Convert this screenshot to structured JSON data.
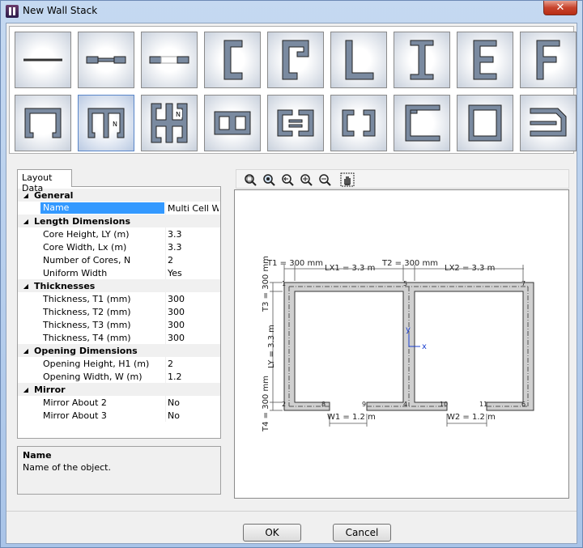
{
  "window": {
    "title": "New Wall Stack",
    "close_glyph": "✕"
  },
  "gallery": {
    "shapes": [
      "straight-wall",
      "wall-with-opening",
      "wall-with-gap",
      "c-section",
      "hooked-c-section",
      "l-section",
      "i-section",
      "e-section",
      "f-section",
      "rectangular-core-with-openings",
      "multi-cell-core",
      "multi-cell-grid",
      "double-wall",
      "twin-channel",
      "box-core-openings",
      "channel-core",
      "octagonal-core",
      "bent-wall"
    ],
    "selected_index": 10
  },
  "tab": {
    "label": "Layout Data"
  },
  "grid": {
    "rows": [
      {
        "type": "cat",
        "label": "General"
      },
      {
        "type": "prop",
        "key": "Name",
        "value": "Multi Cell Wall",
        "selected": true
      },
      {
        "type": "cat",
        "label": "Length Dimensions"
      },
      {
        "type": "prop",
        "key": "Core Height, LY (m)",
        "value": "3.3"
      },
      {
        "type": "prop",
        "key": "Core Width, Lx (m)",
        "value": "3.3"
      },
      {
        "type": "prop",
        "key": "Number of Cores, N",
        "value": "2"
      },
      {
        "type": "prop",
        "key": "Uniform Width",
        "value": "Yes"
      },
      {
        "type": "cat",
        "label": "Thicknesses"
      },
      {
        "type": "prop",
        "key": "Thickness, T1 (mm)",
        "value": "300"
      },
      {
        "type": "prop",
        "key": "Thickness, T2 (mm)",
        "value": "300"
      },
      {
        "type": "prop",
        "key": "Thickness, T3 (mm)",
        "value": "300"
      },
      {
        "type": "prop",
        "key": "Thickness, T4 (mm)",
        "value": "300"
      },
      {
        "type": "cat",
        "label": "Opening Dimensions"
      },
      {
        "type": "prop",
        "key": "Opening Height, H1 (m)",
        "value": "2"
      },
      {
        "type": "prop",
        "key": "Opening Width, W (m)",
        "value": "1.2"
      },
      {
        "type": "cat",
        "label": "Mirror"
      },
      {
        "type": "prop",
        "key": "Mirror About 2",
        "value": "No"
      },
      {
        "type": "prop",
        "key": "Mirror About 3",
        "value": "No"
      }
    ]
  },
  "help": {
    "title": "Name",
    "text": "Name of the object."
  },
  "toolbar": {
    "icons": [
      "zoom-window-icon",
      "zoom-extents-icon",
      "zoom-previous-icon",
      "zoom-in-icon",
      "zoom-out-icon",
      "pan-icon"
    ]
  },
  "drawing": {
    "t1": "T1 = 300 mm",
    "lx1": "LX1 = 3.3 m",
    "t2": "T2 = 300 mm",
    "lx2": "LX2 = 3.3 m",
    "t3": "T3 = 300 mm",
    "ly": "LY = 3.3 m",
    "t4": "T4 = 300 mm",
    "w1": "W1 = 1.2 m",
    "w2": "W2 = 1.2 m",
    "axis_x": "x",
    "axis_y": "y",
    "points": [
      "1",
      "2",
      "3",
      "4",
      "5",
      "6",
      "7",
      "8",
      "9",
      "10",
      "11"
    ]
  },
  "buttons": {
    "ok": "OK",
    "cancel": "Cancel"
  }
}
